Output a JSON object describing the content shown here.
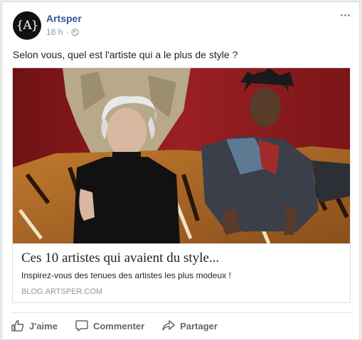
{
  "post": {
    "page_name": "Artsper",
    "avatar_text": "{A}",
    "time": "18 h",
    "separator": "·",
    "privacy_icon": "globe-icon",
    "text": "Selon vous, quel est l'artiste qui a le plus de style ?"
  },
  "link": {
    "title": "Ces 10 artistes qui avaient du style...",
    "description": "Inspirez-vous des tenues des artistes les plus modeux !",
    "domain": "BLOG.ARTSPER.COM"
  },
  "actions": {
    "like_label": "J'aime",
    "comment_label": "Commenter",
    "share_label": "Partager"
  },
  "colors": {
    "link_blue": "#365899",
    "meta_gray": "#90949c",
    "action_gray": "#606770",
    "photo_wall_red": "#8e1a1c"
  }
}
